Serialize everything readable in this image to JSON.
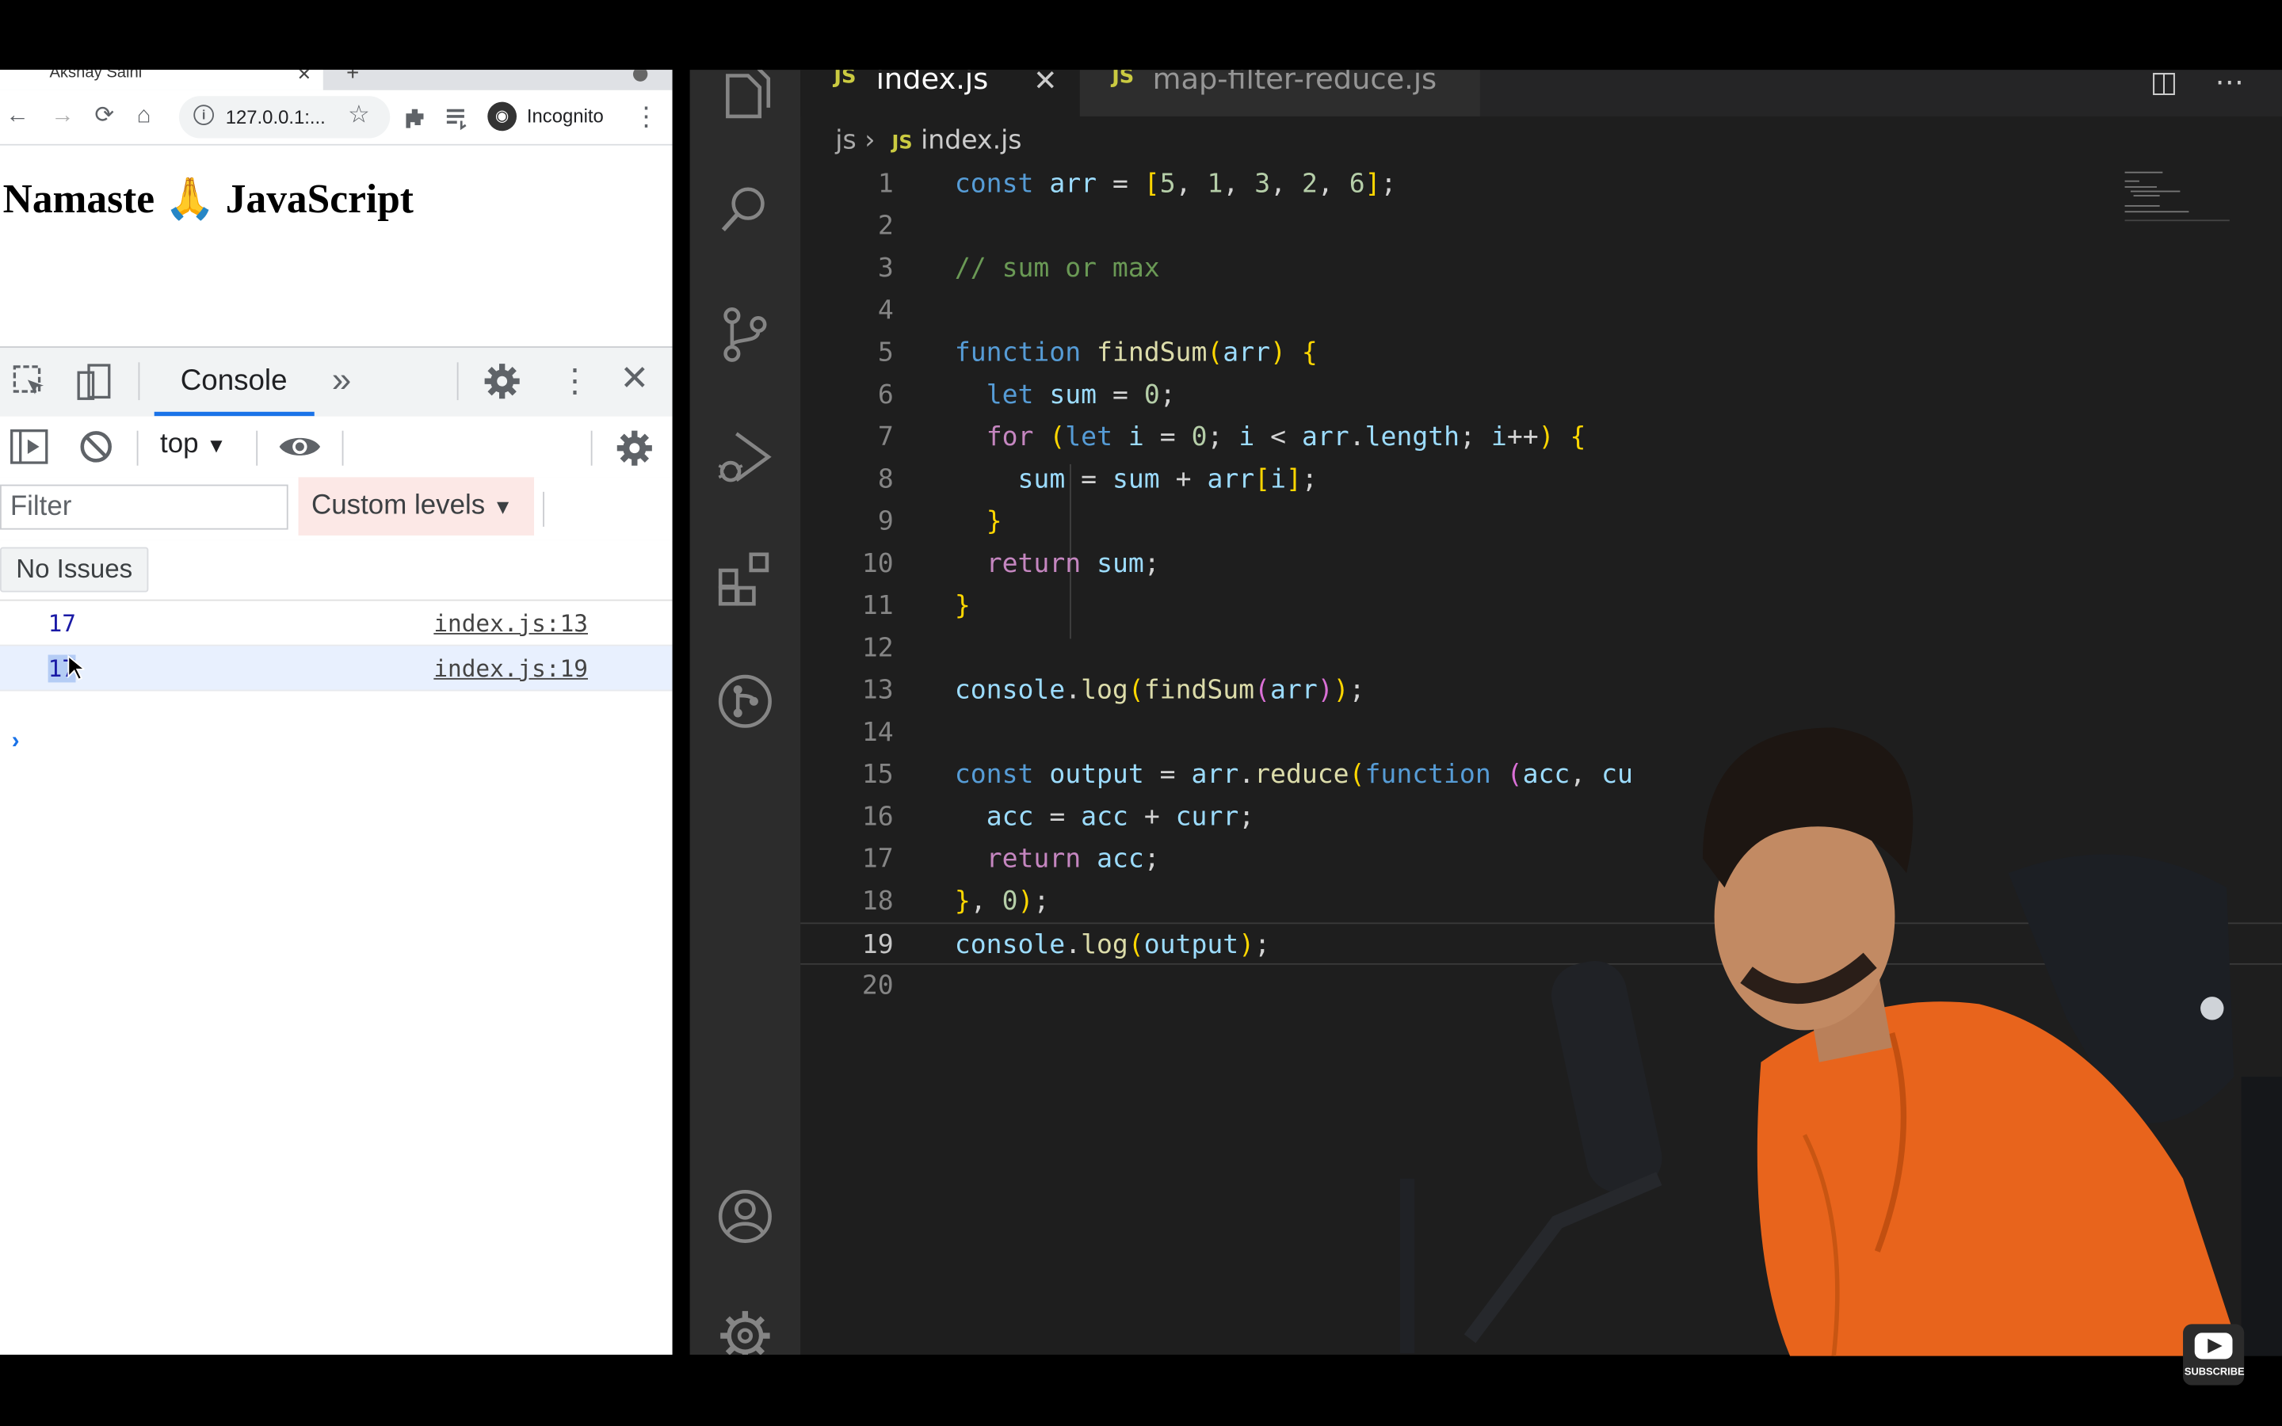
{
  "browser": {
    "tab_title": "Akshay Saini",
    "url": "127.0.0.1:...",
    "incognito_label": "Incognito",
    "page_heading": "Namaste 🙏 JavaScript"
  },
  "devtools": {
    "console_tab": "Console",
    "context": "top",
    "filter_placeholder": "Filter",
    "custom_levels": "Custom levels",
    "no_issues": "No Issues",
    "logs": [
      {
        "value": "17",
        "source": "index.js:13"
      },
      {
        "value": "17",
        "source": "index.js:19"
      }
    ],
    "prompt": "›"
  },
  "editor": {
    "tabs": [
      {
        "icon": "JS",
        "name": "index.js",
        "active": true
      },
      {
        "icon": "JS",
        "name": "map-filter-reduce.js",
        "active": false
      }
    ],
    "breadcrumb": {
      "folder": "js",
      "icon": "JS",
      "file": "index.js"
    },
    "current_line": 19,
    "line_numbers": [
      "1",
      "2",
      "3",
      "4",
      "5",
      "6",
      "7",
      "8",
      "9",
      "10",
      "11",
      "12",
      "13",
      "14",
      "15",
      "16",
      "17",
      "18",
      "19",
      "20"
    ],
    "code_lines": [
      "const arr = [5, 1, 3, 2, 6];",
      "",
      "// sum or max",
      "",
      "function findSum(arr) {",
      "  let sum = 0;",
      "  for (let i = 0; i < arr.length; i++) {",
      "    sum = sum + arr[i];",
      "  }",
      "  return sum;",
      "}",
      "",
      "console.log(findSum(arr));",
      "",
      "const output = arr.reduce(function (acc, cu",
      "  acc = acc + curr;",
      "  return acc;",
      "}, 0);",
      "console.log(output);",
      ""
    ]
  },
  "overlay": {
    "subscribe_label": "SUBSCRIBE"
  },
  "colors": {
    "vscode_bg": "#1e1e1e",
    "activitybar": "#2c2c2c",
    "chrome_blue": "#1a73e8",
    "shirt_orange": "#e8641c"
  }
}
